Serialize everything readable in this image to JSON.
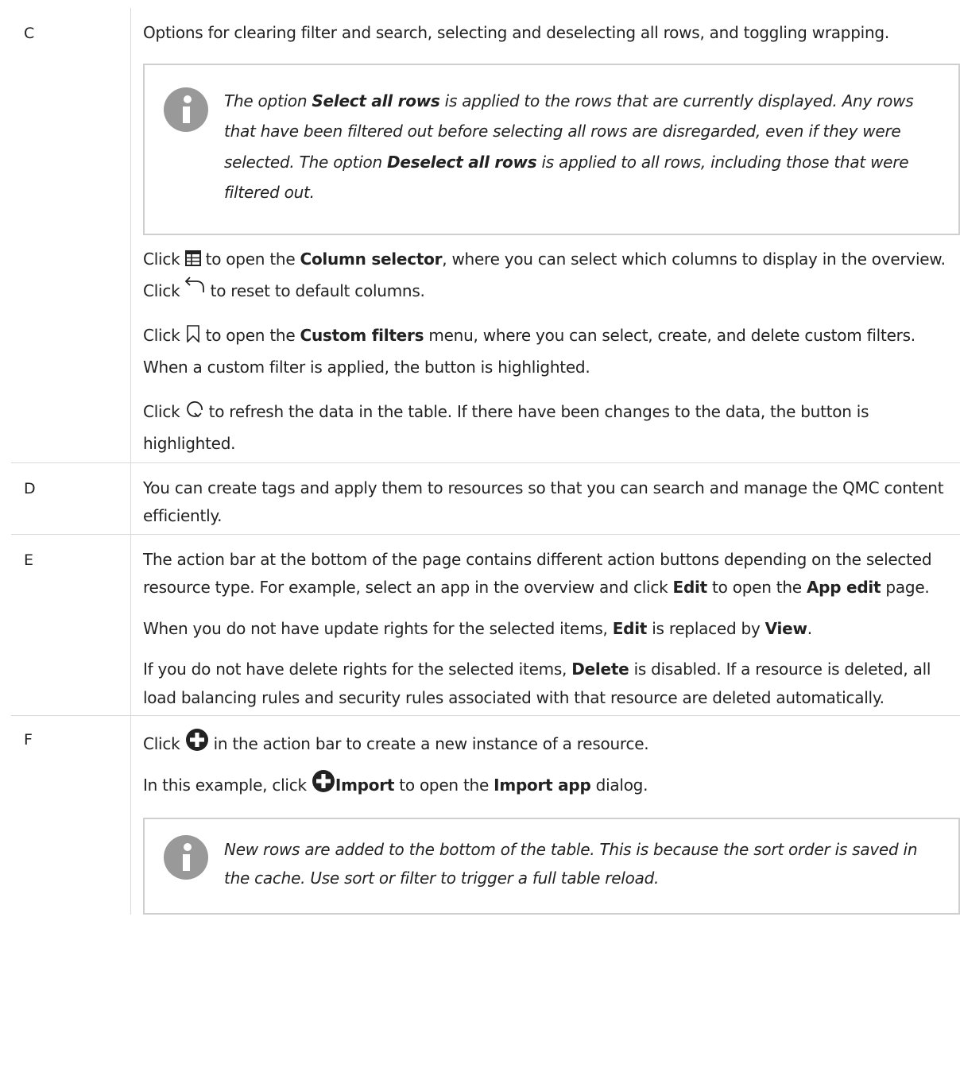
{
  "rows": [
    {
      "key": "C",
      "intro": "Options for clearing filter and search, selecting and deselecting all rows, and toggling wrapping.",
      "note": {
        "p1": "The option ",
        "b1": "Select all rows",
        "p2": " is applied to the rows that are currently displayed. Any rows that have been filtered out before selecting all rows are disregarded, even if they were selected. The option ",
        "b2": "Deselect all rows",
        "p3": " is applied to all rows, including those that were filtered out."
      },
      "column_selector": {
        "a": "Click ",
        "b": " to open the ",
        "bold": "Column selector",
        "c": ", where you can select which columns to display in the overview. Click ",
        "d": " to reset to default columns."
      },
      "custom_filters": {
        "a": "Click ",
        "b": " to open the ",
        "bold": "Custom filters",
        "c": " menu, where you can select, create, and delete custom filters. When a custom filter is applied, the button is highlighted."
      },
      "refresh": {
        "a": "Click ",
        "b": " to refresh the data in the table. If there have been changes to the data, the button is highlighted."
      }
    },
    {
      "key": "D",
      "text": "You can create tags and apply them to resources so that you can search and manage the QMC content efficiently."
    },
    {
      "key": "E",
      "p1": {
        "a": "The action bar at the bottom of the page contains different action buttons depending on the selected resource type. For example, select an app in the overview and click ",
        "b1": "Edit",
        "c": " to open the ",
        "b2": "App edit",
        "d": " page."
      },
      "p2": {
        "a": "When you do not have update rights for the selected items, ",
        "b1": "Edit",
        "c": " is replaced by ",
        "b2": "View",
        "d": "."
      },
      "p3": {
        "a": "If you do not have delete rights for the selected items, ",
        "b1": "Delete",
        "c": " is disabled. If a resource is deleted, all load balancing rules and security rules associated with that resource are deleted automatically."
      }
    },
    {
      "key": "F",
      "p1": {
        "a": "Click ",
        "b": " in the action bar to create a new instance of a resource."
      },
      "p2": {
        "a": "In this example, click ",
        "b1": "Import",
        "c": " to open the ",
        "b2": "Import app",
        "d": " dialog."
      },
      "note": "New rows are added to the bottom of the table. This is because the sort order is saved in the cache. Use sort or filter to trigger a full table reload."
    }
  ],
  "icons": {
    "info": "info-icon",
    "column_selector": "table-grid-icon",
    "reset": "undo-arrow-icon",
    "custom_filters": "bookmark-icon",
    "refresh": "refresh-icon",
    "create": "plus-circle-icon"
  },
  "colors": {
    "border": "#d9d9d9",
    "note_border": "#cfcfcf",
    "info_icon": "#999999"
  }
}
